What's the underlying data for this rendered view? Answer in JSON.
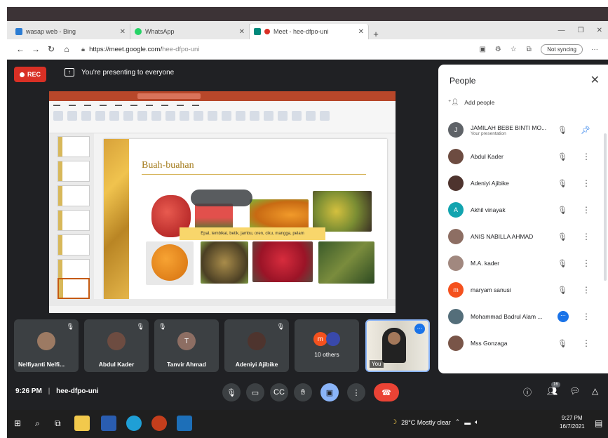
{
  "browser": {
    "tabs": [
      {
        "label": "wasap web - Bing",
        "color": "#2b7cd3"
      },
      {
        "label": "WhatsApp",
        "color": "#25d366"
      },
      {
        "label": "Meet - hee-dfpo-uni",
        "color": "#00897b"
      }
    ],
    "url_host": "https://meet.google.com/",
    "url_path": "hee-dfpo-uni",
    "sync_label": "Not syncing"
  },
  "meet": {
    "rec_label": "REC",
    "presenting_text": "You're presenting to everyone",
    "slide": {
      "heading": "Buah-buahan",
      "caption": "Epal, tembikai, betik, jambu, oren, ciku, mangga, pelam"
    },
    "people_panel": {
      "title": "People",
      "add_people": "Add people",
      "participants": [
        {
          "name": "JAMILAH BEBE BINTI MO...",
          "sub": "Your presentation",
          "initial": "J",
          "color": "#5f6368",
          "action": "pin"
        },
        {
          "name": "Abdul Kader",
          "sub": "",
          "initial": "",
          "color": "#6d4c41",
          "action": "more"
        },
        {
          "name": "Adeniyi Ajibike",
          "sub": "",
          "initial": "",
          "color": "#4e342e",
          "action": "more"
        },
        {
          "name": "Akhil vinayak",
          "sub": "",
          "initial": "A",
          "color": "#12a4af",
          "action": "more"
        },
        {
          "name": "ANIS NABILLA AHMAD",
          "sub": "",
          "initial": "",
          "color": "#8d6e63",
          "action": "more"
        },
        {
          "name": "M.A. kader",
          "sub": "",
          "initial": "",
          "color": "#a1887f",
          "action": "more"
        },
        {
          "name": "maryam sanusi",
          "sub": "",
          "initial": "m",
          "color": "#f4511e",
          "action": "more"
        },
        {
          "name": "Mohammad Badrul Alam ...",
          "sub": "",
          "initial": "",
          "color": "#546e7a",
          "action": "dots"
        },
        {
          "name": "Mss Gonzaga",
          "sub": "",
          "initial": "",
          "color": "#795548",
          "action": "more"
        }
      ]
    },
    "tiles": [
      {
        "name": "Nelfiyanti Nelfi...",
        "initial": "",
        "color": "#9c7a63"
      },
      {
        "name": "Abdul Kader",
        "initial": "",
        "color": "#6d4c41"
      },
      {
        "name": "Tanvir Ahmad",
        "initial": "T",
        "color": "#8d6e63"
      },
      {
        "name": "Adeniyi Ajibike",
        "initial": "",
        "color": "#4e342e"
      },
      {
        "name": "10 others",
        "initial": "m",
        "color": "#f4511e"
      }
    ],
    "you_label": "You",
    "meeting_time": "9:26 PM",
    "meeting_code": "hee-dfpo-uni",
    "people_count": "16"
  },
  "taskbar": {
    "weather": "28°C  Mostly clear",
    "time": "9:27 PM",
    "date": "16/7/2021"
  }
}
